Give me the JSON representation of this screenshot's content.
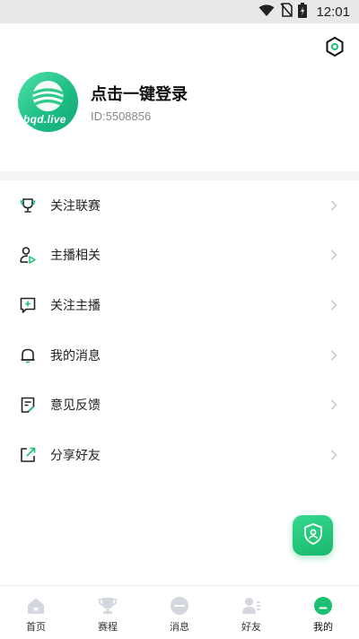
{
  "status_bar": {
    "time": "12:01"
  },
  "profile": {
    "avatar_text": "bqd.live",
    "login_prompt": "点击一键登录",
    "user_id": "ID:5508856"
  },
  "menu": [
    {
      "label": "关注联赛",
      "icon": "trophy-icon"
    },
    {
      "label": "主播相关",
      "icon": "streamer-icon"
    },
    {
      "label": "关注主播",
      "icon": "follow-streamer-icon"
    },
    {
      "label": "我的消息",
      "icon": "bell-icon"
    },
    {
      "label": "意见反馈",
      "icon": "feedback-icon"
    },
    {
      "label": "分享好友",
      "icon": "share-icon"
    }
  ],
  "tabs": [
    {
      "label": "首页",
      "icon": "home-icon",
      "active": false
    },
    {
      "label": "赛程",
      "icon": "schedule-icon",
      "active": false
    },
    {
      "label": "消息",
      "icon": "message-icon",
      "active": false
    },
    {
      "label": "好友",
      "icon": "friends-icon",
      "active": false
    },
    {
      "label": "我的",
      "icon": "profile-icon",
      "active": true
    }
  ],
  "colors": {
    "accent": "#1dbf73",
    "tab_inactive": "#d4d8de",
    "divider": "#f3f4f6"
  }
}
